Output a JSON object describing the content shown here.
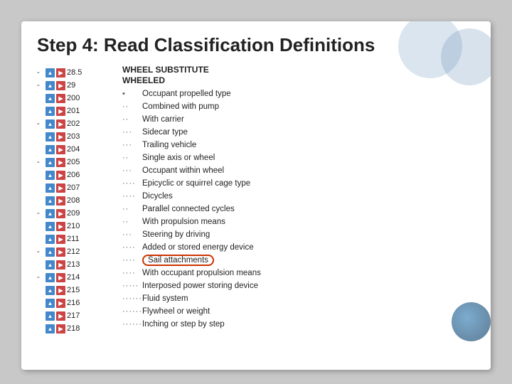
{
  "slide": {
    "title": "Step 4: Read Classification Definitions",
    "section_header_1": "WHEEL SUBSTITUTE",
    "section_header_2": "WHEELED",
    "codes": [
      {
        "dash": "-",
        "num": "28.5"
      },
      {
        "dash": "-",
        "num": "29"
      },
      {
        "dash": "",
        "num": "200"
      },
      {
        "dash": "",
        "num": "201"
      },
      {
        "dash": "-",
        "num": "202"
      },
      {
        "dash": "",
        "num": "203"
      },
      {
        "dash": "",
        "num": "204"
      },
      {
        "dash": "-",
        "num": "205"
      },
      {
        "dash": "",
        "num": "206"
      },
      {
        "dash": "",
        "num": "207"
      },
      {
        "dash": "",
        "num": "208"
      },
      {
        "dash": "-",
        "num": "209"
      },
      {
        "dash": "",
        "num": "210"
      },
      {
        "dash": "",
        "num": "211"
      },
      {
        "dash": "-",
        "num": "212"
      },
      {
        "dash": "",
        "num": "213"
      },
      {
        "dash": "-",
        "num": "214"
      },
      {
        "dash": "",
        "num": "215"
      },
      {
        "dash": "",
        "num": "216"
      },
      {
        "dash": "",
        "num": "217"
      },
      {
        "dash": "",
        "num": "218"
      }
    ],
    "definitions": [
      {
        "dots": "•",
        "text": "Occupant propelled type",
        "highlighted": false
      },
      {
        "dots": "··",
        "text": "Combined with pump",
        "highlighted": false
      },
      {
        "dots": "··",
        "text": "With carrier",
        "highlighted": false
      },
      {
        "dots": "···",
        "text": "Sidecar type",
        "highlighted": false
      },
      {
        "dots": "···",
        "text": "Trailing vehicle",
        "highlighted": false
      },
      {
        "dots": "··",
        "text": "Single axis or wheel",
        "highlighted": false
      },
      {
        "dots": "···",
        "text": "Occupant within wheel",
        "highlighted": false
      },
      {
        "dots": "····",
        "text": "Epicyclic or squirrel cage type",
        "highlighted": false
      },
      {
        "dots": "····",
        "text": "Dicycles",
        "highlighted": false
      },
      {
        "dots": "··",
        "text": "Parallel connected cycles",
        "highlighted": false
      },
      {
        "dots": "··",
        "text": "With propulsion means",
        "highlighted": false
      },
      {
        "dots": "···",
        "text": "Steering by driving",
        "highlighted": false
      },
      {
        "dots": "····",
        "text": "Added or stored energy device",
        "highlighted": false
      },
      {
        "dots": "····",
        "text": "Sail attachments",
        "highlighted": true
      },
      {
        "dots": "····",
        "text": "With occupant propulsion means",
        "highlighted": false
      },
      {
        "dots": "·····",
        "text": "Interposed power storing device",
        "highlighted": false
      },
      {
        "dots": "······",
        "text": "Fluid system",
        "highlighted": false
      },
      {
        "dots": "······",
        "text": "Flywheel or weight",
        "highlighted": false
      },
      {
        "dots": "······",
        "text": "Inching or step by step",
        "highlighted": false
      }
    ]
  }
}
